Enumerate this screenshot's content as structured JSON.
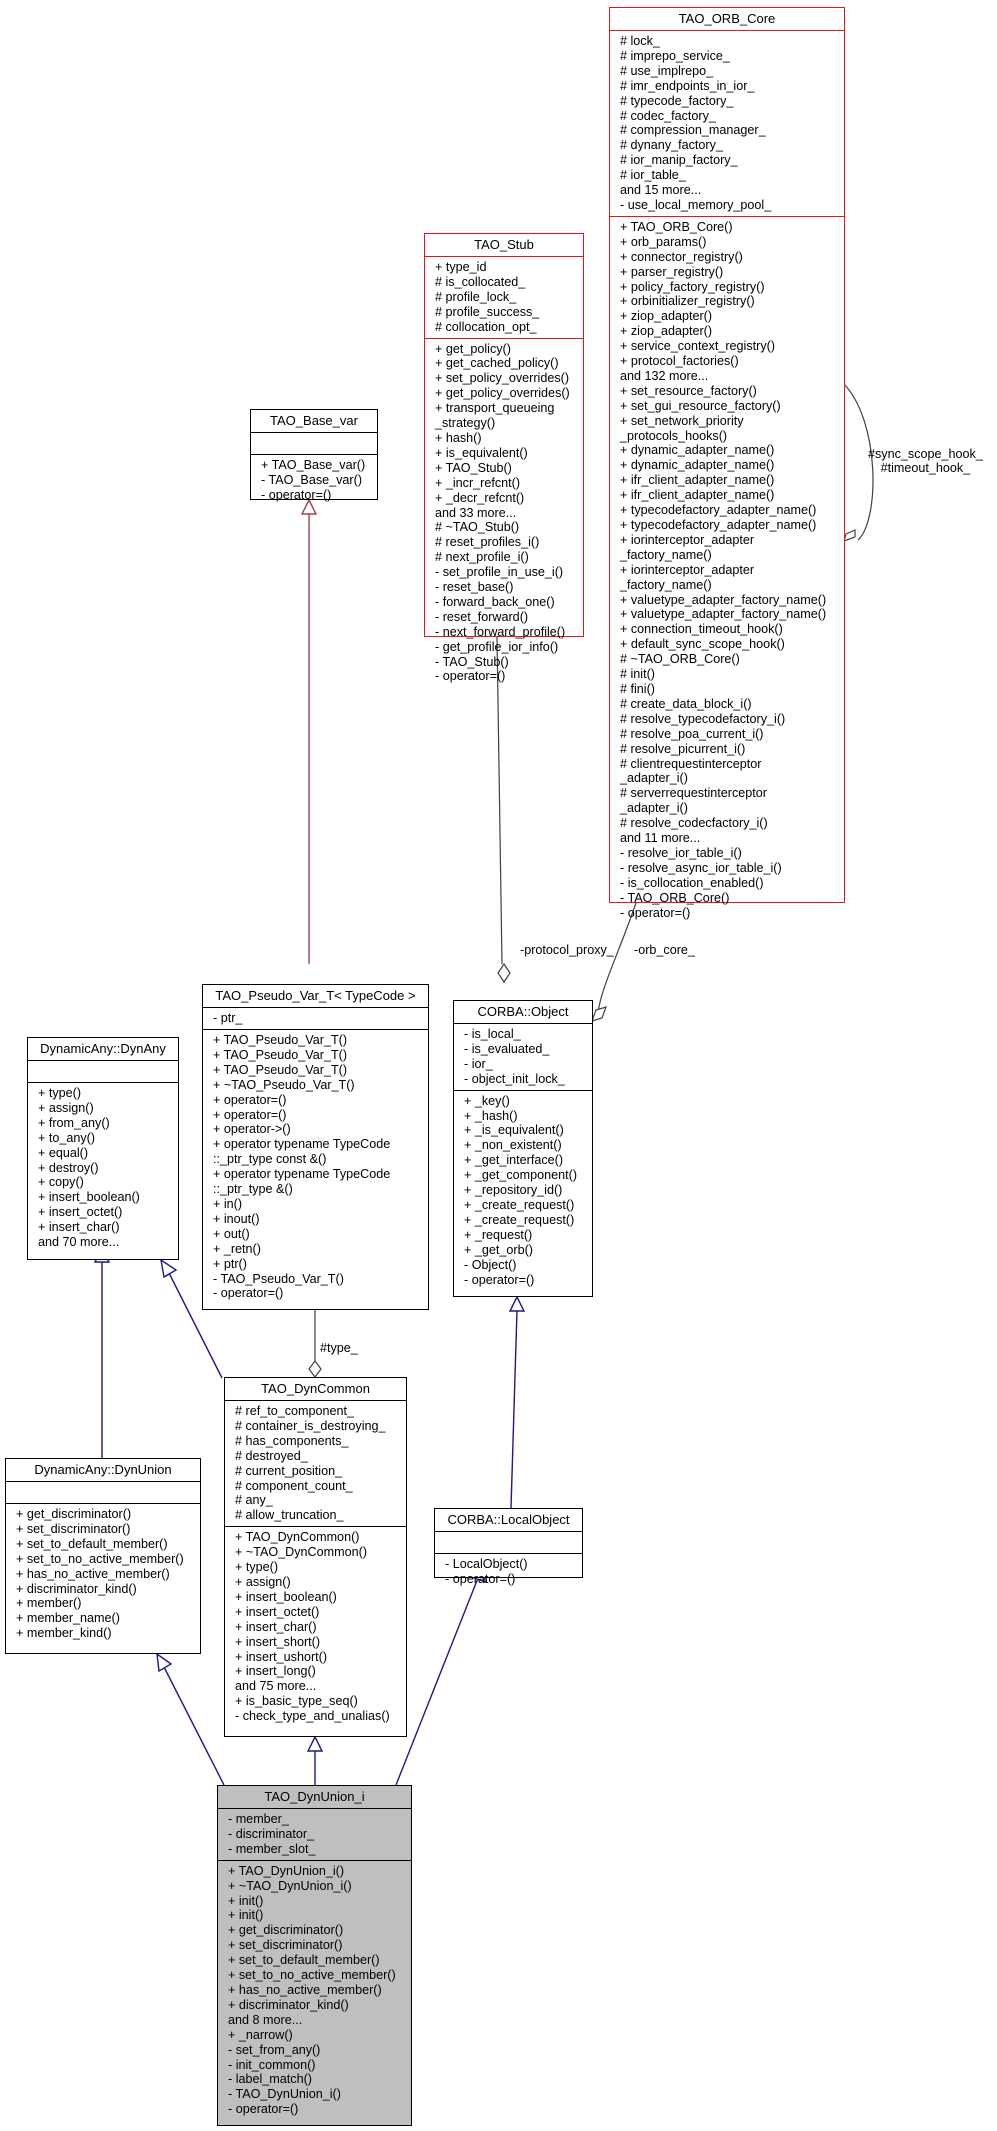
{
  "diagram": {
    "type": "uml-collaboration-diagram",
    "colors": {
      "inheritance_edge": "#1a1a8c",
      "template_edge": "#a0434b",
      "usage_edge": "#404040",
      "truncated_class_border": "#e8161c",
      "focus_class_fill": "#bfbfbf"
    },
    "classes": {
      "orb_core": {
        "name": "TAO_ORB_Core",
        "attributes": [
          "# lock_",
          "# imprepo_service_",
          "# use_implrepo_",
          "# imr_endpoints_in_ior_",
          "# typecode_factory_",
          "# codec_factory_",
          "# compression_manager_",
          "# dynany_factory_",
          "# ior_manip_factory_",
          "# ior_table_",
          "and 15 more...",
          "- use_local_memory_pool_"
        ],
        "methods": [
          "+ TAO_ORB_Core()",
          "+ orb_params()",
          "+ connector_registry()",
          "+ parser_registry()",
          "+ policy_factory_registry()",
          "+ orbinitializer_registry()",
          "+ ziop_adapter()",
          "+ ziop_adapter()",
          "+ service_context_registry()",
          "+ protocol_factories()",
          "and 132 more...",
          "+ set_resource_factory()",
          "+ set_gui_resource_factory()",
          "+ set_network_priority",
          "_protocols_hooks()",
          "+ dynamic_adapter_name()",
          "+ dynamic_adapter_name()",
          "+ ifr_client_adapter_name()",
          "+ ifr_client_adapter_name()",
          "+ typecodefactory_adapter_name()",
          "+ typecodefactory_adapter_name()",
          "+ iorinterceptor_adapter",
          "_factory_name()",
          "+ iorinterceptor_adapter",
          "_factory_name()",
          "+ valuetype_adapter_factory_name()",
          "+ valuetype_adapter_factory_name()",
          "+ connection_timeout_hook()",
          "+ default_sync_scope_hook()",
          "# ~TAO_ORB_Core()",
          "# init()",
          "# fini()",
          "# create_data_block_i()",
          "# resolve_typecodefactory_i()",
          "# resolve_poa_current_i()",
          "# resolve_picurrent_i()",
          "# clientrequestinterceptor",
          "_adapter_i()",
          "# serverrequestinterceptor",
          "_adapter_i()",
          "# resolve_codecfactory_i()",
          "and 11 more...",
          "- resolve_ior_table_i()",
          "- resolve_async_ior_table_i()",
          "- is_collocation_enabled()",
          "- TAO_ORB_Core()",
          "- operator=()"
        ]
      },
      "stub": {
        "name": "TAO_Stub",
        "attributes": [
          "+ type_id",
          "# is_collocated_",
          "# profile_lock_",
          "# profile_success_",
          "# collocation_opt_"
        ],
        "methods": [
          "+ get_policy()",
          "+ get_cached_policy()",
          "+ set_policy_overrides()",
          "+ get_policy_overrides()",
          "+ transport_queueing",
          "_strategy()",
          "+ hash()",
          "+ is_equivalent()",
          "+ TAO_Stub()",
          "+ _incr_refcnt()",
          "+ _decr_refcnt()",
          "and 33 more...",
          "# ~TAO_Stub()",
          "# reset_profiles_i()",
          "# next_profile_i()",
          "- set_profile_in_use_i()",
          "- reset_base()",
          "- forward_back_one()",
          "- reset_forward()",
          "- next_forward_profile()",
          "- get_profile_ior_info()",
          "- TAO_Stub()",
          "- operator=()"
        ]
      },
      "base_var": {
        "name": "TAO_Base_var",
        "attributes": [],
        "methods": [
          "+ TAO_Base_var()",
          "- TAO_Base_var()",
          "- operator=()"
        ]
      },
      "pseudo_var": {
        "name": "TAO_Pseudo_Var_T< TypeCode >",
        "attributes": [
          "- ptr_"
        ],
        "methods": [
          "+ TAO_Pseudo_Var_T()",
          "+ TAO_Pseudo_Var_T()",
          "+ TAO_Pseudo_Var_T()",
          "+ ~TAO_Pseudo_Var_T()",
          "+ operator=()",
          "+ operator=()",
          "+ operator->()",
          "+ operator typename TypeCode",
          "::_ptr_type const &()",
          "+ operator typename TypeCode",
          "::_ptr_type &()",
          "+ in()",
          "+ inout()",
          "+ out()",
          "+ _retn()",
          "+ ptr()",
          "- TAO_Pseudo_Var_T()",
          "- operator=()"
        ]
      },
      "dynany": {
        "name": "DynamicAny::DynAny",
        "attributes": [],
        "methods": [
          "+ type()",
          "+ assign()",
          "+ from_any()",
          "+ to_any()",
          "+ equal()",
          "+ destroy()",
          "+ copy()",
          "+ insert_boolean()",
          "+ insert_octet()",
          "+ insert_char()",
          "and 70 more..."
        ]
      },
      "corba_object": {
        "name": "CORBA::Object",
        "attributes": [
          "- is_local_",
          "- is_evaluated_",
          "- ior_",
          "- object_init_lock_"
        ],
        "methods": [
          "+ _key()",
          "+ _hash()",
          "+ _is_equivalent()",
          "+ _non_existent()",
          "+ _get_interface()",
          "+ _get_component()",
          "+ _repository_id()",
          "+ _create_request()",
          "+ _create_request()",
          "+ _request()",
          "+ _get_orb()",
          "- Object()",
          "- operator=()"
        ]
      },
      "dyncommon": {
        "name": "TAO_DynCommon",
        "attributes": [
          "# ref_to_component_",
          "# container_is_destroying_",
          "# has_components_",
          "# destroyed_",
          "# current_position_",
          "# component_count_",
          "# any_",
          "# allow_truncation_"
        ],
        "methods": [
          "+ TAO_DynCommon()",
          "+ ~TAO_DynCommon()",
          "+ type()",
          "+ assign()",
          "+ insert_boolean()",
          "+ insert_octet()",
          "+ insert_char()",
          "+ insert_short()",
          "+ insert_ushort()",
          "+ insert_long()",
          "and 75 more...",
          "+ is_basic_type_seq()",
          "- check_type_and_unalias()"
        ]
      },
      "dynunion": {
        "name": "DynamicAny::DynUnion",
        "attributes": [],
        "methods": [
          "+ get_discriminator()",
          "+ set_discriminator()",
          "+ set_to_default_member()",
          "+ set_to_no_active_member()",
          "+ has_no_active_member()",
          "+ discriminator_kind()",
          "+ member()",
          "+ member_name()",
          "+ member_kind()"
        ]
      },
      "local_object": {
        "name": "CORBA::LocalObject",
        "attributes": [],
        "methods": [
          "- LocalObject()",
          "- operator=()"
        ]
      },
      "dynunion_i": {
        "name": "TAO_DynUnion_i",
        "attributes": [
          "- member_",
          "- discriminator_",
          "- member_slot_"
        ],
        "methods": [
          "+ TAO_DynUnion_i()",
          "+ ~TAO_DynUnion_i()",
          "+ init()",
          "+ init()",
          "+ get_discriminator()",
          "+ set_discriminator()",
          "+ set_to_default_member()",
          "+ set_to_no_active_member()",
          "+ has_no_active_member()",
          "+ discriminator_kind()",
          "and 8 more...",
          "+ _narrow()",
          "- set_from_any()",
          "- init_common()",
          "- label_match()",
          "- TAO_DynUnion_i()",
          "- operator=()"
        ]
      }
    },
    "edge_labels": {
      "sync_scope": "#sync_scope_hook_\n#timeout_hook_",
      "protocol_proxy": "-protocol_proxy_",
      "orb_core": "-orb_core_",
      "type": "#type_"
    }
  }
}
